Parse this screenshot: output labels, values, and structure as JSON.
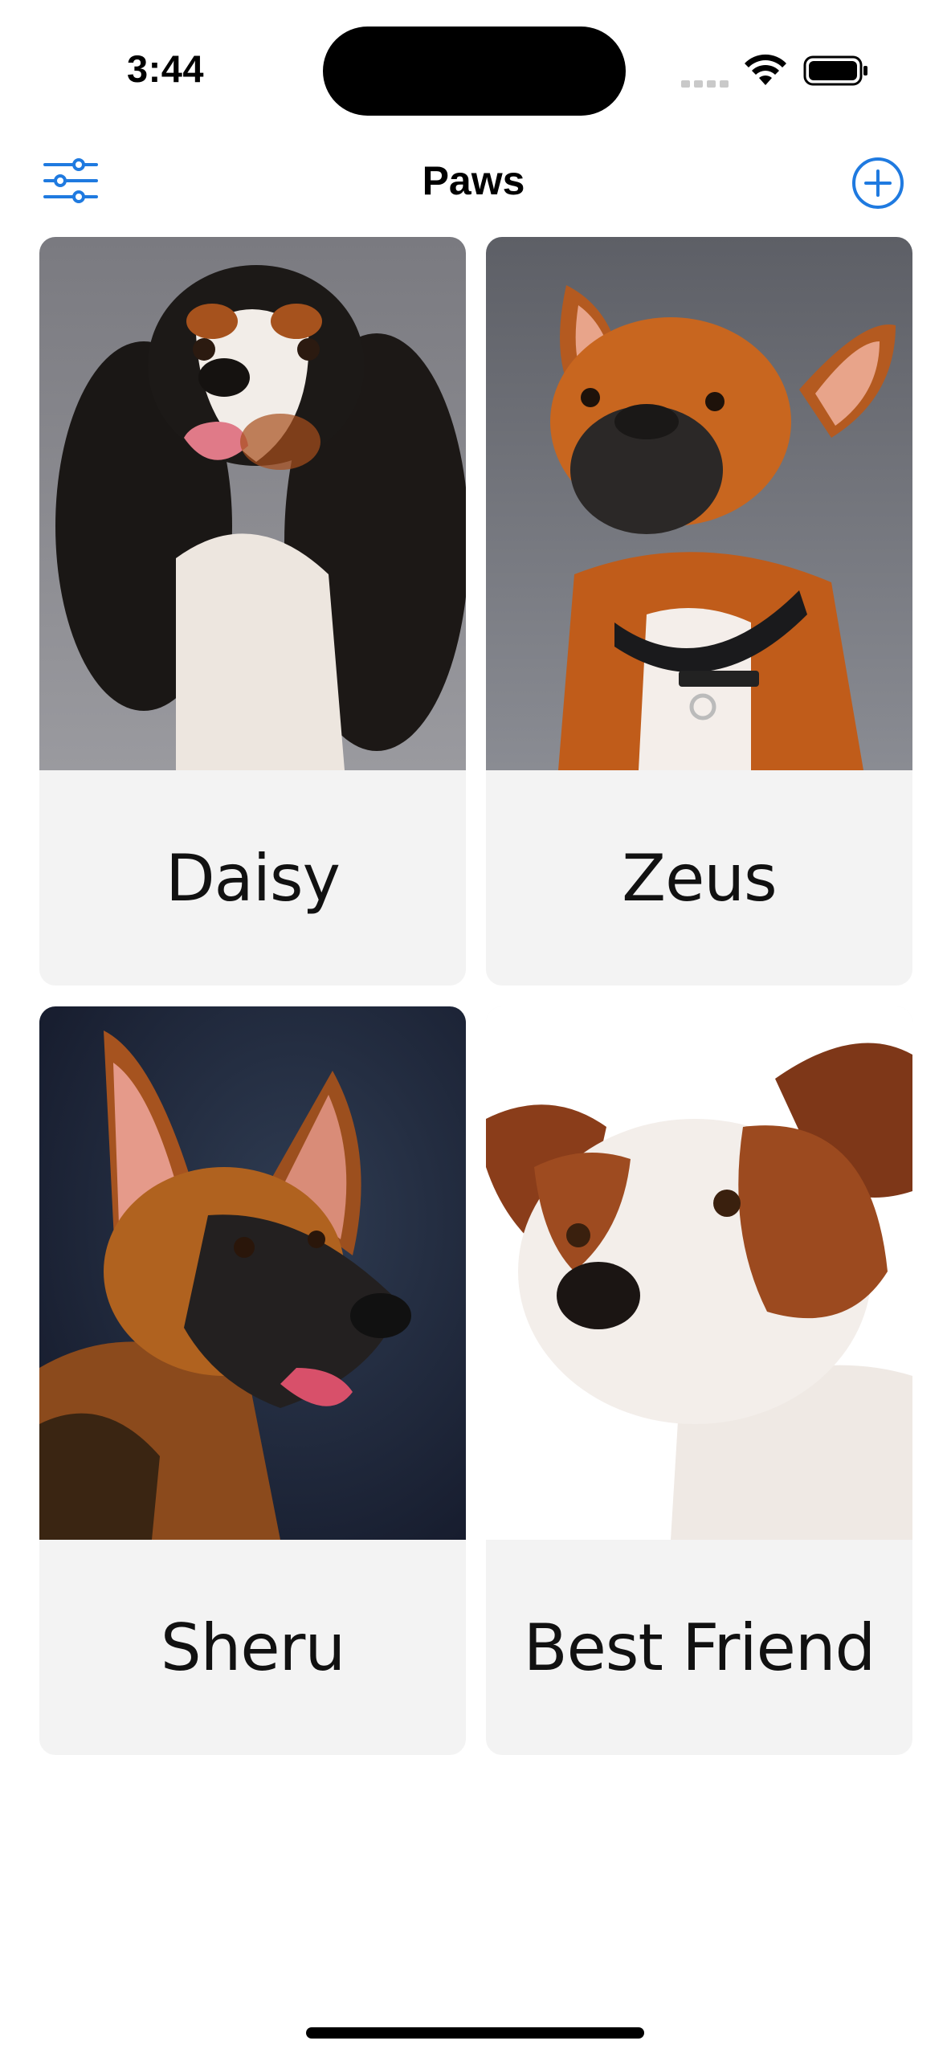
{
  "status_bar": {
    "time": "3:44",
    "icons": [
      "cellular-signal-icon",
      "wifi-icon",
      "battery-icon"
    ]
  },
  "nav": {
    "title": "Paws",
    "left_icon": "sliders-filter-icon",
    "right_icon": "plus-circle-icon",
    "accent_color": "#1f7ae0"
  },
  "pets": [
    {
      "name": "Daisy",
      "photo": "cavalier-king-charles-spaniel"
    },
    {
      "name": "Zeus",
      "photo": "french-bulldog"
    },
    {
      "name": "Sheru",
      "photo": "german-shepherd"
    },
    {
      "name": "Best Friend",
      "photo": "jack-russell-terrier"
    }
  ],
  "colors": {
    "card_background": "#f3f3f3",
    "page_background": "#ffffff",
    "label_text": "#111111"
  }
}
